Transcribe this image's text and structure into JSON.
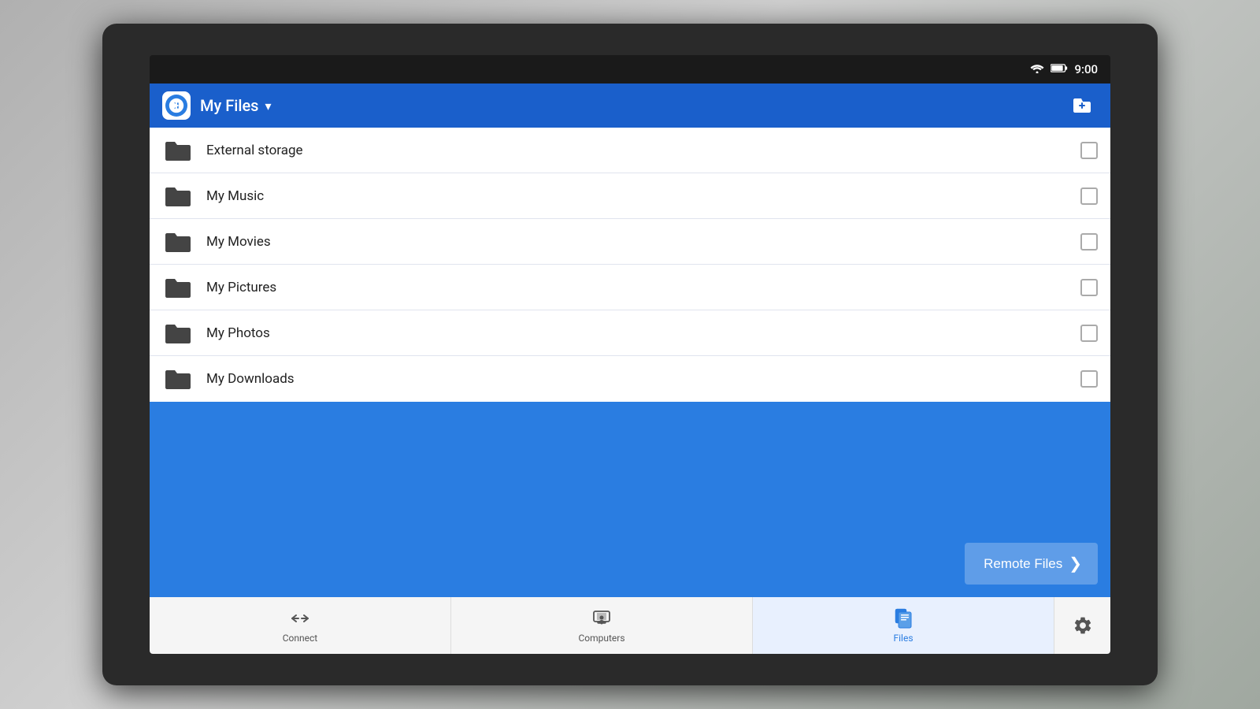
{
  "statusBar": {
    "time": "9:00"
  },
  "header": {
    "title": "My Files",
    "chevron": "▾",
    "newFolderLabel": "new-folder"
  },
  "fileList": {
    "items": [
      {
        "id": 1,
        "name": "External storage"
      },
      {
        "id": 2,
        "name": "My Music"
      },
      {
        "id": 3,
        "name": "My Movies"
      },
      {
        "id": 4,
        "name": "My Pictures"
      },
      {
        "id": 5,
        "name": "My Photos"
      },
      {
        "id": 6,
        "name": "My Downloads"
      }
    ]
  },
  "remoteFiles": {
    "label": "Remote Files",
    "chevron": "❯"
  },
  "bottomNav": {
    "items": [
      {
        "id": "connect",
        "label": "Connect",
        "active": false
      },
      {
        "id": "computers",
        "label": "Computers",
        "active": false
      },
      {
        "id": "files",
        "label": "Files",
        "active": true
      }
    ],
    "settingsIcon": "⚙"
  },
  "colors": {
    "headerBg": "#1a5fcb",
    "appBg": "#2a7de1",
    "activeTab": "#2a7de1",
    "white": "#ffffff"
  }
}
